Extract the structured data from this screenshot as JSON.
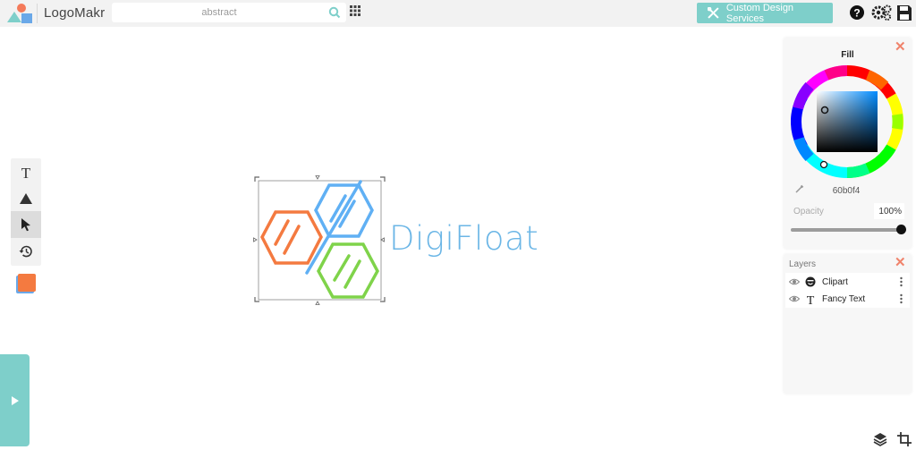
{
  "header": {
    "app_title": "LogoMakr",
    "search_placeholder": "abstract",
    "custom_design_label": "Custom Design Services",
    "help_icon": "help-icon",
    "settings_icon": "gear-icon",
    "save_icon": "save-icon"
  },
  "tools": [
    {
      "name": "text-tool",
      "icon": "text-icon"
    },
    {
      "name": "shape-tool",
      "icon": "triangle-icon"
    },
    {
      "name": "select-tool",
      "icon": "pointer-icon",
      "active": true
    },
    {
      "name": "history-tool",
      "icon": "history-icon"
    }
  ],
  "current_color": "#f47a40",
  "canvas": {
    "brand_text": "DigiFloat",
    "colors": {
      "orange": "#f47a40",
      "blue": "#60b0f4",
      "green": "#7fd34a"
    }
  },
  "fill_panel": {
    "title": "Fill",
    "hex_value": "60b0f4",
    "opacity_label": "Opacity",
    "opacity_value": "100%",
    "opacity": 1.0
  },
  "layers_panel": {
    "title": "Layers",
    "items": [
      {
        "label": "Clipart",
        "icon": "clipart-icon"
      },
      {
        "label": "Fancy Text",
        "icon": "text-icon"
      }
    ]
  },
  "accent_color": "#7ecfca",
  "close_color": "#f0836b"
}
